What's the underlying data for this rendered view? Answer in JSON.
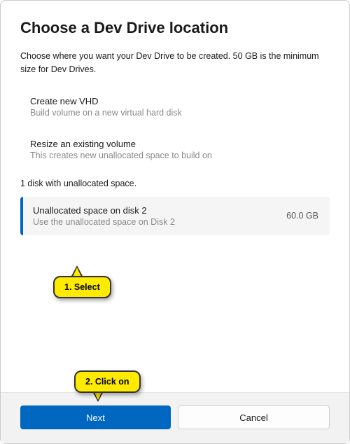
{
  "title": "Choose a Dev Drive location",
  "subtitle": "Choose where you want your Dev Drive to be created. 50 GB is the minimum size for Dev Drives.",
  "options": [
    {
      "title": "Create new VHD",
      "desc": "Build volume on a new virtual hard disk"
    },
    {
      "title": "Resize an existing volume",
      "desc": "This creates new unallocated space to build on"
    }
  ],
  "disk_count_text": "1 disk with unallocated space.",
  "selected": {
    "title": "Unallocated space on disk 2",
    "desc": "Use the unallocated space on Disk 2",
    "size": "60.0 GB"
  },
  "buttons": {
    "next": "Next",
    "cancel": "Cancel"
  },
  "callouts": {
    "select": "1. Select",
    "click": "2. Click on"
  }
}
